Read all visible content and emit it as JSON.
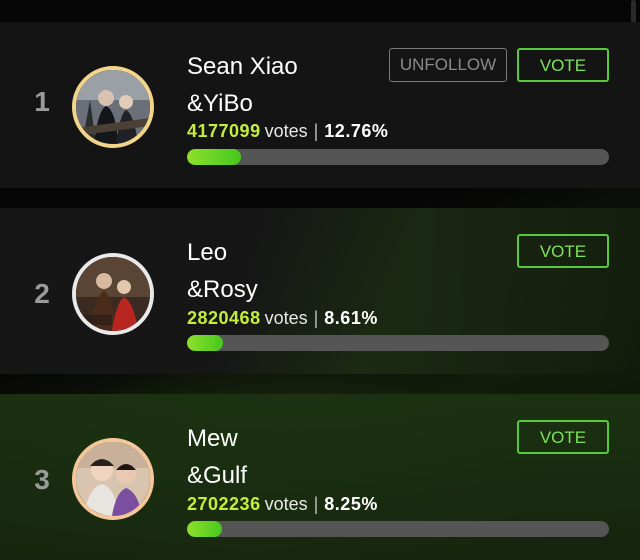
{
  "colors": {
    "accent": "#58c93a",
    "votes_highlight": "#c5ee3c",
    "progress_fill": "#5fd423",
    "progress_track": "#555555"
  },
  "ranking": [
    {
      "rank": "1",
      "name_line1": "Sean Xiao",
      "name_line2": "&YiBo",
      "votes": "4177099",
      "votes_word": "votes",
      "separator": "|",
      "percent": "12.76%",
      "progress_fraction": 0.1276,
      "unfollow_label": "UNFOLLOW",
      "vote_label": "VOTE",
      "avatar_icon": "couple-photo-avatar"
    },
    {
      "rank": "2",
      "name_line1": "Leo",
      "name_line2": "&Rosy",
      "votes": "2820468",
      "votes_word": "votes",
      "separator": "|",
      "percent": "8.61%",
      "progress_fraction": 0.0861,
      "vote_label": "VOTE",
      "avatar_icon": "couple-photo-avatar"
    },
    {
      "rank": "3",
      "name_line1": "Mew",
      "name_line2": "&Gulf",
      "votes": "2702236",
      "votes_word": "votes",
      "separator": "|",
      "percent": "8.25%",
      "progress_fraction": 0.0825,
      "vote_label": "VOTE",
      "avatar_icon": "couple-photo-avatar"
    }
  ]
}
